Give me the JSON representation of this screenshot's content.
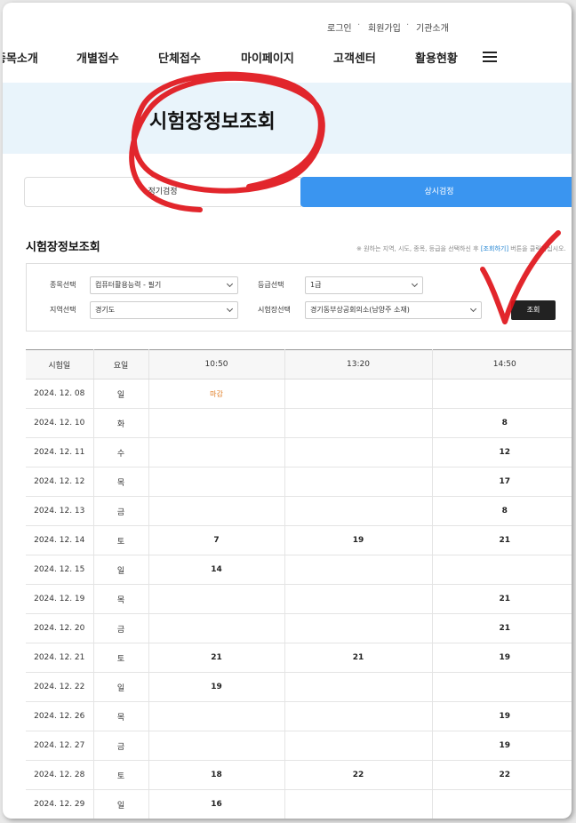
{
  "util_nav": [
    "로그인",
    "회원가입",
    "기관소개"
  ],
  "gnb": [
    "종목소개",
    "개별접수",
    "단체접수",
    "마이페이지",
    "고객센터",
    "활용현황"
  ],
  "hero_title": "시험장정보조회",
  "tabs": {
    "regular": "정기검정",
    "always": "상시검정"
  },
  "section_title": "시험장정보조회",
  "section_note": {
    "prefix": "※ 원하는 지역, 시도, 종목, 등급을 선택하신 후 ",
    "link": "[조회하기]",
    "suffix": " 버튼을 클릭하십시오."
  },
  "filters": {
    "subject_label": "종목선택",
    "subject_value": "컴퓨터활용능력 - 필기",
    "grade_label": "등급선택",
    "grade_value": "1급",
    "region_label": "지역선택",
    "region_value": "경기도",
    "site_label": "시험장선택",
    "site_value": "경기동부상공회의소(남양주 소재)",
    "search_button": "조회"
  },
  "table": {
    "headers": [
      "시험일",
      "요일",
      "10:50",
      "13:20",
      "14:50"
    ],
    "rows": [
      [
        "2024. 12. 08",
        "일",
        "마감",
        "",
        ""
      ],
      [
        "2024. 12. 10",
        "화",
        "",
        "",
        "8"
      ],
      [
        "2024. 12. 11",
        "수",
        "",
        "",
        "12"
      ],
      [
        "2024. 12. 12",
        "목",
        "",
        "",
        "17"
      ],
      [
        "2024. 12. 13",
        "금",
        "",
        "",
        "8"
      ],
      [
        "2024. 12. 14",
        "토",
        "7",
        "19",
        "21"
      ],
      [
        "2024. 12. 15",
        "일",
        "14",
        "",
        ""
      ],
      [
        "2024. 12. 19",
        "목",
        "",
        "",
        "21"
      ],
      [
        "2024. 12. 20",
        "금",
        "",
        "",
        "21"
      ],
      [
        "2024. 12. 21",
        "토",
        "21",
        "21",
        "19"
      ],
      [
        "2024. 12. 22",
        "일",
        "19",
        "",
        ""
      ],
      [
        "2024. 12. 26",
        "목",
        "",
        "",
        "19"
      ],
      [
        "2024. 12. 27",
        "금",
        "",
        "",
        "19"
      ],
      [
        "2024. 12. 28",
        "토",
        "18",
        "22",
        "22"
      ],
      [
        "2024. 12. 29",
        "일",
        "16",
        "",
        ""
      ]
    ]
  },
  "colors": {
    "accent": "#3a95f0",
    "hero_bg": "#e9f4fb",
    "annotation": "#e0141a",
    "closed": "#e07a1f"
  }
}
